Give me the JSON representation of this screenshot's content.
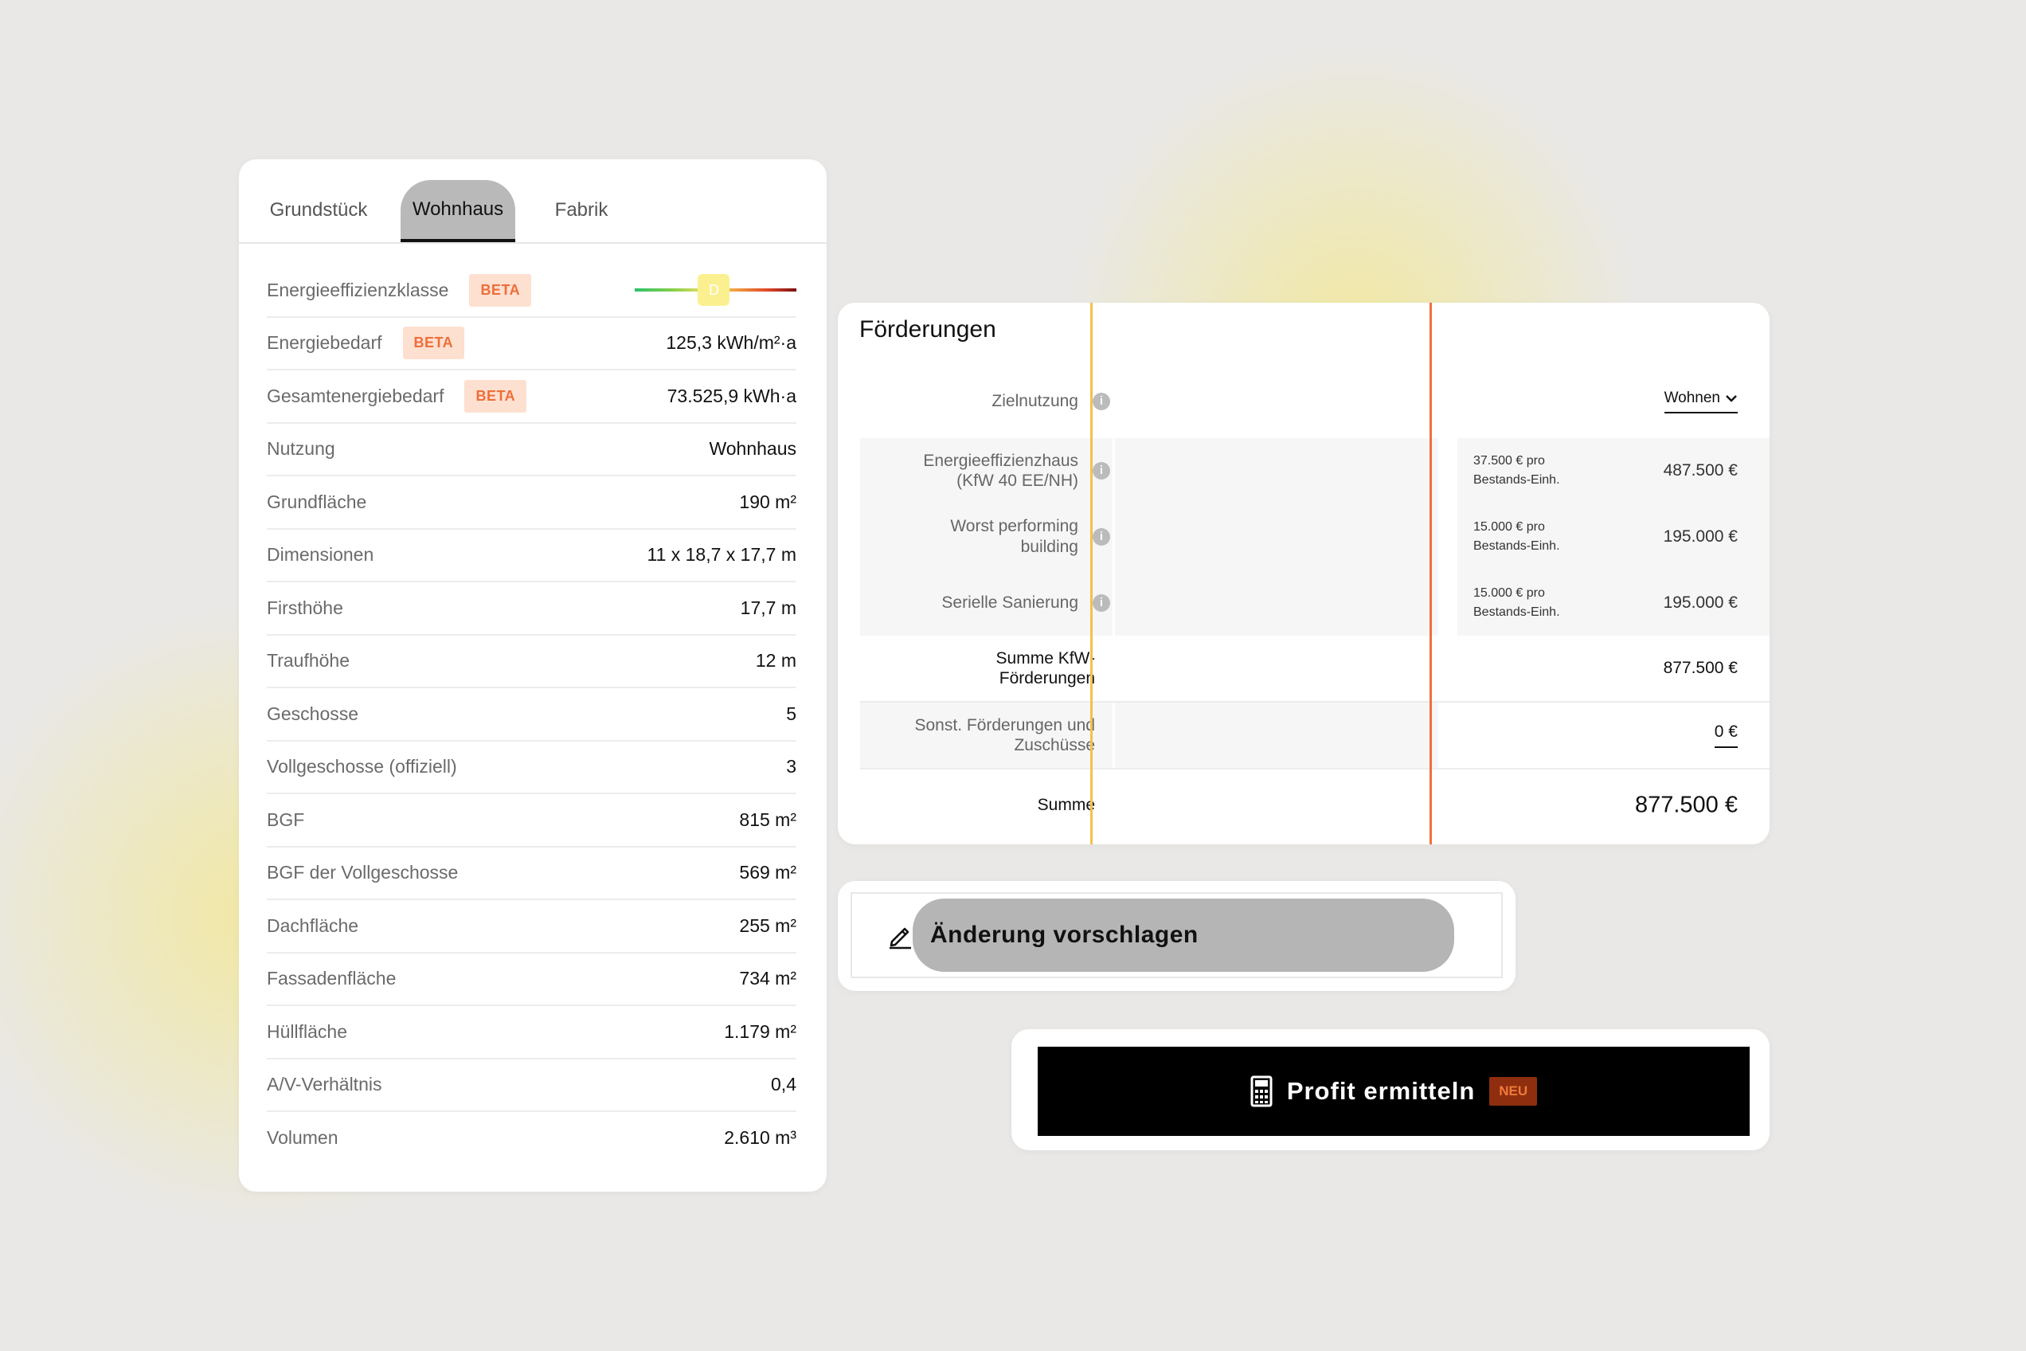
{
  "tabs": [
    {
      "label": "Grundstück"
    },
    {
      "label": "Wohnhaus"
    },
    {
      "label": "Fabrik"
    }
  ],
  "energy_scale": {
    "marker": "D",
    "level_fraction": 0.49
  },
  "properties": [
    {
      "label": "Energieeffizienzklasse",
      "badge": "BETA",
      "value": ""
    },
    {
      "label": "Energiebedarf",
      "badge": "BETA",
      "value": "125,3 kWh/m²·a"
    },
    {
      "label": "Gesamtenergiebedarf",
      "badge": "BETA",
      "value": "73.525,9 kWh·a"
    },
    {
      "label": "Nutzung",
      "value": "Wohnhaus"
    },
    {
      "label": "Grundfläche",
      "value": "190 m²"
    },
    {
      "label": "Dimensionen",
      "value": "11 x 18,7 x 17,7 m"
    },
    {
      "label": "Firsthöhe",
      "value": "17,7 m"
    },
    {
      "label": "Traufhöhe",
      "value": "12 m"
    },
    {
      "label": "Geschosse",
      "value": "5"
    },
    {
      "label": "Vollgeschosse (offiziell)",
      "value": "3"
    },
    {
      "label": "BGF",
      "value": "815 m²"
    },
    {
      "label": "BGF der Vollgeschosse",
      "value": "569 m²"
    },
    {
      "label": "Dachfläche",
      "value": "255 m²"
    },
    {
      "label": "Fassadenfläche",
      "value": "734 m²"
    },
    {
      "label": "Hüllfläche",
      "value": "1.179 m²"
    },
    {
      "label": "A/V-Verhältnis",
      "value": "0,4"
    },
    {
      "label": "Volumen",
      "value": "2.610 m³"
    }
  ],
  "funding": {
    "title": "Förderungen",
    "zielnutzung": {
      "label": "Zielnutzung",
      "value": "Wohnen"
    },
    "items": [
      {
        "label": "Energieeffizienzhaus (KfW 40 EE/NH)",
        "detail_1": "37.500 € pro",
        "detail_2": "Bestands-Einh.",
        "amount": "487.500 €"
      },
      {
        "label": "Worst performing building",
        "detail_1": "15.000 € pro",
        "detail_2": "Bestands-Einh.",
        "amount": "195.000 €"
      },
      {
        "label": "Serielle Sanierung",
        "detail_1": "15.000 € pro",
        "detail_2": "Bestands-Einh.",
        "amount": "195.000 €"
      }
    ],
    "sum_kfw": {
      "label": "Summe KfW-Förderungen",
      "amount": "877.500 €"
    },
    "other": {
      "label": "Sonst. Förderungen und Zuschüsse",
      "amount": "0 €"
    },
    "total": {
      "label": "Summe",
      "amount": "877.500 €"
    },
    "colors": {
      "line_1": "#f5c04a",
      "line_2": "#f0703a"
    }
  },
  "suggest": {
    "label": "Änderung vorschlagen",
    "icon": "pencil-icon"
  },
  "profit": {
    "label": "Profit ermitteln",
    "badge": "NEU",
    "icon": "calculator-icon"
  }
}
